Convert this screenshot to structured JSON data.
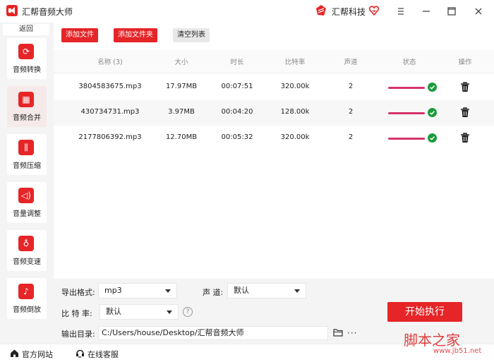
{
  "app": {
    "title": "汇帮音频大师",
    "brand": "汇帮科技"
  },
  "sidebar": {
    "back": "返回",
    "items": [
      {
        "label": "音频转换",
        "icon": "convert-icon"
      },
      {
        "label": "音频合并",
        "icon": "merge-icon"
      },
      {
        "label": "音频压缩",
        "icon": "compress-icon"
      },
      {
        "label": "音量调整",
        "icon": "volume-icon"
      },
      {
        "label": "音频变速",
        "icon": "speed-icon"
      },
      {
        "label": "音频倒放",
        "icon": "reverse-icon"
      }
    ],
    "active_index": 1
  },
  "toolbar": {
    "add_file": "添加文件",
    "add_folder": "添加文件夹",
    "clear_list": "清空列表"
  },
  "table": {
    "headers": {
      "name": "名称 (3)",
      "size": "大小",
      "duration": "时长",
      "bitrate": "比特率",
      "channels": "声道",
      "status": "状态",
      "action": "操作"
    },
    "rows": [
      {
        "name": "3804583675.mp3",
        "size": "17.97MB",
        "duration": "00:07:51",
        "bitrate": "320.00k",
        "channels": "2",
        "progress": 1.0
      },
      {
        "name": "430734731.mp3",
        "size": "3.97MB",
        "duration": "00:04:20",
        "bitrate": "128.00k",
        "channels": "2",
        "progress": 1.0
      },
      {
        "name": "2177806392.mp3",
        "size": "12.70MB",
        "duration": "00:05:32",
        "bitrate": "320.00k",
        "channels": "2",
        "progress": 1.0
      }
    ]
  },
  "settings": {
    "format_label": "导出格式:",
    "format_value": "mp3",
    "channel_label": "声 道:",
    "channel_value": "默认",
    "bitrate_label": "比 特 率:",
    "bitrate_value": "默认",
    "help": "?",
    "outdir_label": "输出目录:",
    "outdir_value": "C:/Users/house/Desktop/汇帮音频大师",
    "more": "···",
    "start": "开始执行"
  },
  "footer": {
    "website": "官方网站",
    "support": "在线客服"
  },
  "watermark": {
    "main": "脚本之家",
    "sub": "www.jb51.net"
  },
  "colors": {
    "accent": "#e52527",
    "progress": "#d6336c",
    "done": "#1a9b3c"
  }
}
